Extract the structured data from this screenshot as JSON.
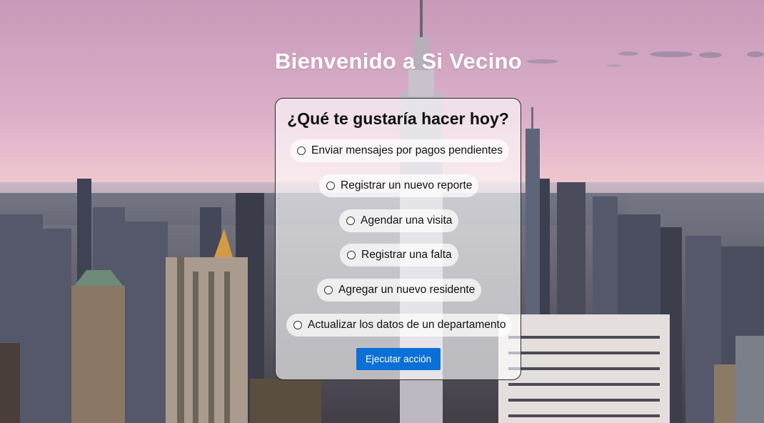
{
  "header": {
    "title": "Bienvenido a Si Vecino"
  },
  "panel": {
    "question": "¿Qué te gustaría hacer hoy?",
    "options": [
      {
        "label": "Enviar mensajes por pagos pendientes",
        "selected": false
      },
      {
        "label": "Registrar un nuevo reporte",
        "selected": false
      },
      {
        "label": "Agendar una visita",
        "selected": false
      },
      {
        "label": "Registrar una falta",
        "selected": false
      },
      {
        "label": "Agregar un nuevo residente",
        "selected": false
      },
      {
        "label": "Actualizar los datos de un departamento",
        "selected": false
      }
    ],
    "submit_label": "Ejecutar acción"
  },
  "colors": {
    "accent": "#0a6fd6",
    "sky_top": "#c89fbf",
    "sky_horizon": "#f2c9c6"
  }
}
